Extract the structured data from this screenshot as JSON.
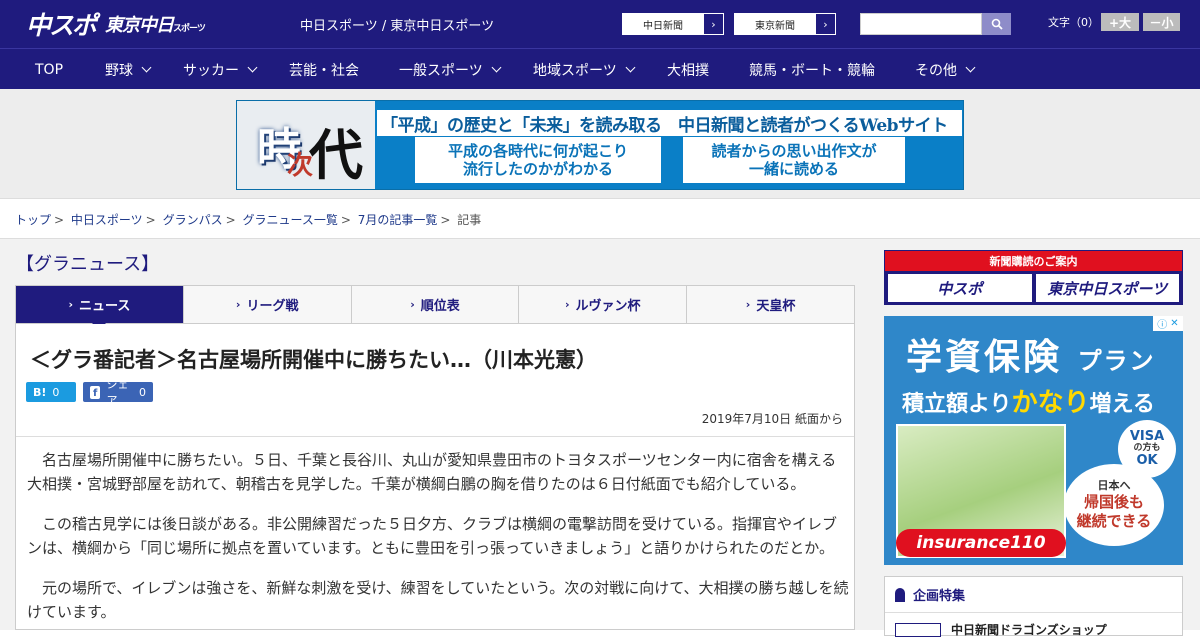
{
  "header": {
    "logo_main": "中スポ",
    "logo_sub": "東京中日",
    "logo_sub_small": "スポーツ",
    "site_title": "中日スポーツ / 東京中日スポーツ",
    "site_links": [
      "中日新聞",
      "東京新聞"
    ],
    "search_placeholder": "",
    "font_size_label": "文字（0）",
    "font_larger": "+大",
    "font_smaller": "－小"
  },
  "nav": [
    {
      "label": "TOP",
      "has_menu": false
    },
    {
      "label": "野球",
      "has_menu": true
    },
    {
      "label": "サッカー",
      "has_menu": true
    },
    {
      "label": "芸能・社会",
      "has_menu": false
    },
    {
      "label": "一般スポーツ",
      "has_menu": true
    },
    {
      "label": "地域スポーツ",
      "has_menu": true
    },
    {
      "label": "大相撲",
      "has_menu": false
    },
    {
      "label": "競馬・ボート・競輪",
      "has_menu": false
    },
    {
      "label": "その他",
      "has_menu": true
    }
  ],
  "banner": {
    "kanji_1": "時",
    "kanji_2": "次",
    "kanji_3": "代",
    "headline": "「平成」の歴史と「未来」を読み取る　中日新聞と読者がつくるWebサイト",
    "sub_left": "平成の各時代に何が起こり\n流行したのかがわかる",
    "sub_right": "読者からの思い出作文が\n一緒に読める"
  },
  "breadcrumb": {
    "items": [
      "トップ",
      "中日スポーツ",
      "グランパス",
      "グラニュース一覧",
      "7月の記事一覧"
    ],
    "current": "記事",
    "separator": ">"
  },
  "section_title": "【グラニュース】",
  "tabs": [
    {
      "label": "ニュース",
      "active": true
    },
    {
      "label": "リーグ戦",
      "active": false
    },
    {
      "label": "順位表",
      "active": false
    },
    {
      "label": "ルヴァン杯",
      "active": false
    },
    {
      "label": "天皇杯",
      "active": false
    }
  ],
  "article": {
    "title": "＜グラ番記者＞名古屋場所開催中に勝ちたい…（川本光憲）",
    "hatena_label": "B!",
    "hatena_count": "0",
    "fb_label": "シェア",
    "fb_count": "0",
    "date": "2019年7月10日 紙面から",
    "paragraphs": [
      "名古屋場所開催中に勝ちたい。５日、千葉と長谷川、丸山が愛知県豊田市のトヨタスポーツセンター内に宿舎を構える大相撲・宮城野部屋を訪れて、朝稽古を見学した。千葉が横綱白鵬の胸を借りたのは６日付紙面でも紹介している。",
      "この稽古見学には後日談がある。非公開練習だった５日夕方、クラブは横綱の電撃訪問を受けている。指揮官やイレブンは、横綱から「同じ場所に拠点を置いています。ともに豊田を引っ張っていきましょう」と語りかけられたのだとか。",
      "元の場所で、イレブンは強さを、新鮮な刺激を受け、練習をしていたという。次の対戦に向けて、大相撲の勝ち越しを続けています。"
    ]
  },
  "sidebar": {
    "subscribe_title": "新聞購読のご案内",
    "subscribe_btn_1": "中スポ",
    "subscribe_btn_2": "東京中日スポーツ",
    "ad": {
      "line1": "学資保険",
      "line1_small": "プラン",
      "line2_a": "積立額より",
      "line2_b": "かなり",
      "line2_c": "増える",
      "visa_1": "VISA",
      "visa_2": "の方も",
      "visa_3": "OK",
      "jp_1": "日本へ",
      "jp_2": "帰国後も",
      "jp_3": "継続できる",
      "brand": "insurance110"
    },
    "feature_title": "企画特集",
    "feature_item": "中日新聞ドラゴンズショップ"
  },
  "colors": {
    "brand_navy": "#1f1b7e",
    "banner_blue": "#0a7fc7",
    "subscribe_red": "#e0101f",
    "hatena_blue": "#1b9be0",
    "fb_blue": "#3b64b5"
  }
}
